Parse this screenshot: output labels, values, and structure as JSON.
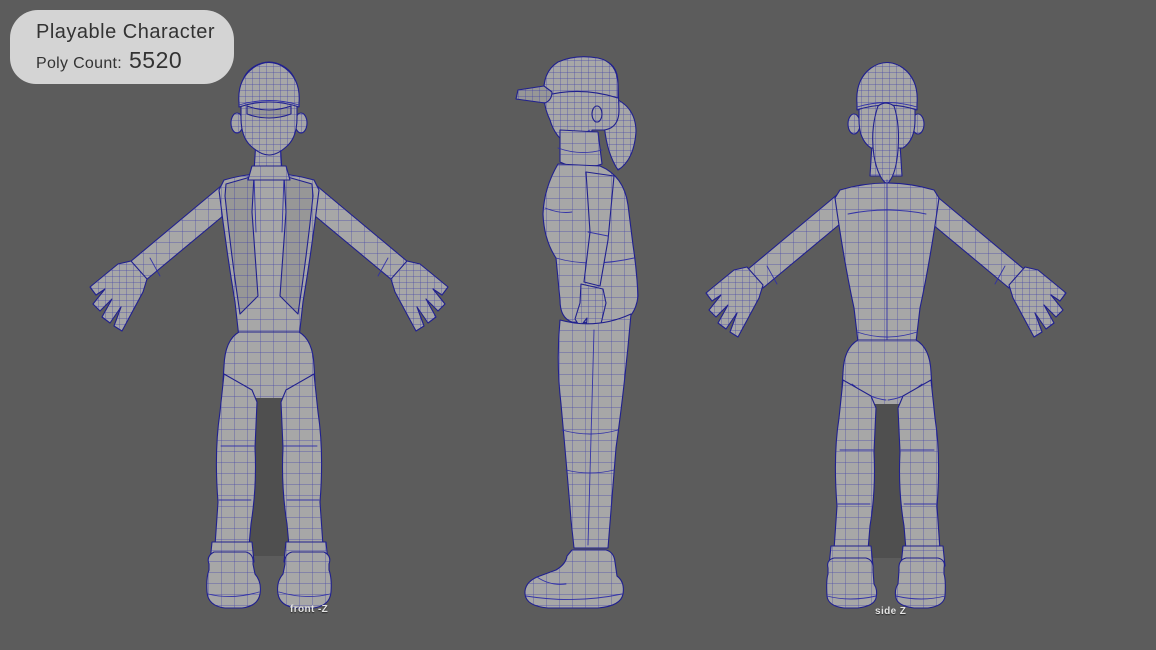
{
  "badge": {
    "title": "Playable Character",
    "poly_count_label": "Poly Count:",
    "poly_count_value": "5520"
  },
  "view_labels": {
    "left_panel": "front -Z",
    "right_panel": "side Z"
  },
  "colors": {
    "background": "#5c5c5c",
    "model_fill": "#a7a7a7",
    "model_fill_dark": "#979797",
    "shadow": "#4f4f4f",
    "wireframe": "#2e2ea8",
    "wireframe_dark": "#20208e",
    "badge_bg": "#d4d4d4",
    "badge_text": "#333333",
    "label_text": "#e3e3e3"
  }
}
